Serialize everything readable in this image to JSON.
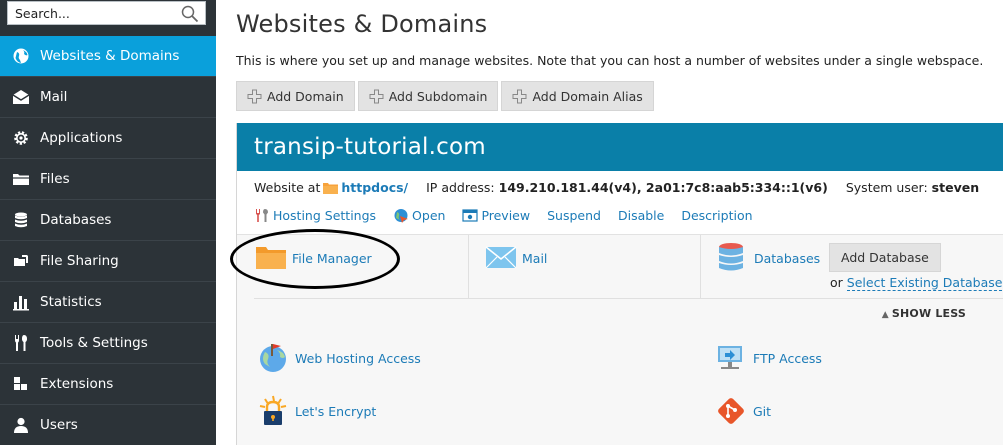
{
  "search": {
    "placeholder": "Search..."
  },
  "sidebar": {
    "items": [
      {
        "label": "Websites & Domains",
        "icon": "globe-icon",
        "active": true
      },
      {
        "label": "Mail",
        "icon": "envelope-icon"
      },
      {
        "label": "Applications",
        "icon": "gear-icon"
      },
      {
        "label": "Files",
        "icon": "folder-icon"
      },
      {
        "label": "Databases",
        "icon": "database-icon"
      },
      {
        "label": "File Sharing",
        "icon": "file-sharing-icon"
      },
      {
        "label": "Statistics",
        "icon": "bar-chart-icon"
      },
      {
        "label": "Tools & Settings",
        "icon": "tools-icon"
      },
      {
        "label": "Extensions",
        "icon": "puzzle-icon"
      },
      {
        "label": "Users",
        "icon": "user-icon"
      }
    ]
  },
  "main": {
    "title": "Websites & Domains",
    "description": "This is where you set up and manage websites. Note that you can host a number of websites under a single webspace.",
    "toolbar": {
      "add_domain": "Add Domain",
      "add_subdomain": "Add Subdomain",
      "add_domain_alias": "Add Domain Alias"
    },
    "domain": {
      "name": "transip-tutorial.com",
      "website_at_label": "Website at",
      "docroot": "httpdocs/",
      "ip_label": "IP address:",
      "ip_value": "149.210.181.44(v4), 2a01:7c8:aab5:334::1(v6)",
      "sysuser_label": "System user:",
      "sysuser_value": "steven",
      "actions": {
        "hosting_settings": "Hosting Settings",
        "open": "Open",
        "preview": "Preview",
        "suspend": "Suspend",
        "disable": "Disable",
        "description": "Description"
      },
      "tiles": {
        "file_manager": "File Manager",
        "mail": "Mail",
        "databases": "Databases",
        "add_database": "Add Database",
        "or": "or",
        "select_existing_database": "Select Existing Database"
      },
      "show_less": "SHOW LESS",
      "features": {
        "web_hosting_access": "Web Hosting Access",
        "ftp_access": "FTP Access",
        "lets_encrypt": "Let's Encrypt",
        "git": "Git"
      }
    }
  },
  "colors": {
    "sidebar_bg": "#2c3338",
    "sidebar_active": "#0aa0db",
    "domain_header": "#0a7fa8",
    "link": "#1c7bb7"
  }
}
